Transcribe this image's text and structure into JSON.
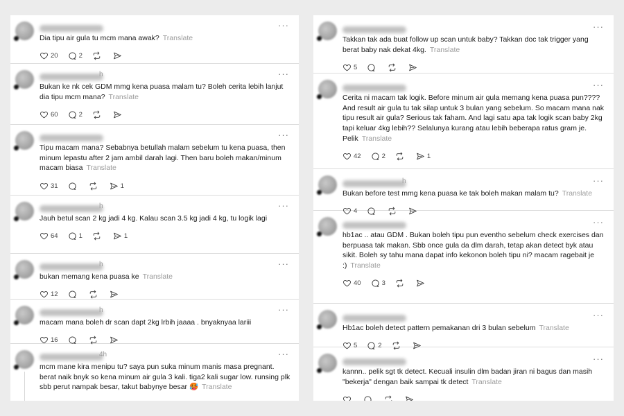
{
  "left": [
    {
      "time": "",
      "text": "Dia tipu air gula tu mcm mana awak?",
      "translate": "Translate",
      "likes": "20",
      "replies": "2",
      "reposts": "",
      "shares": ""
    },
    {
      "time": "h",
      "text": "Bukan ke nk cek GDM mmg kena puasa malam tu? Boleh cerita lebih lanjut dia tipu mcm mana?",
      "translate": "Translate",
      "likes": "60",
      "replies": "2",
      "reposts": "",
      "shares": ""
    },
    {
      "time": "",
      "text": "Tipu macam mana? Sebabnya betullah malam sebelum tu kena puasa, then minum lepastu after 2 jam ambil darah lagi. Then baru boleh makan/minum macam biasa",
      "translate": "Translate",
      "likes": "31",
      "replies": "",
      "reposts": "",
      "shares": "1"
    },
    {
      "time": "h",
      "text": "Jauh betul scan 2 kg jadi 4 kg. Kalau scan 3.5 kg jadi 4 kg, tu logik lagi",
      "translate": "",
      "likes": "64",
      "replies": "1",
      "reposts": "",
      "shares": "1"
    },
    {
      "time": "h",
      "text": "bukan memang kena puasa ke",
      "translate": "Translate",
      "likes": "12",
      "replies": "",
      "reposts": "",
      "shares": ""
    },
    {
      "time": "h",
      "text": "macam mana boleh dr scan dapt 2kg lrbih jaaaa . bnyaknyaa lariii",
      "translate": "",
      "likes": "16",
      "replies": "",
      "reposts": "",
      "shares": ""
    },
    {
      "time": "4h",
      "text": "mcm mane kira menipu tu? saya pun suka minum manis masa pregnant. berat naik bnyk so kena minum air gula 3 kali. tiga2 kali sugar low. runsing plk sbb perut nampak besar, takut babynye besar 🥵",
      "translate": "Translate",
      "likes": "",
      "replies": "",
      "reposts": "",
      "shares": ""
    }
  ],
  "right": [
    {
      "time": "",
      "text": "Takkan tak ada buat follow up scan untuk baby? Takkan doc tak trigger yang berat baby nak dekat 4kg.",
      "translate": "Translate",
      "likes": "5",
      "replies": "",
      "reposts": "",
      "shares": ""
    },
    {
      "time": "",
      "text": "Cerita ni macam tak logik. Before minum air gula memang kena puasa pun???? And result air gula tu tak silap untuk 3 bulan yang sebelum. So macam mana nak tipu result air gula? Serious tak faham. And lagi satu apa tak logik scan baby 2kg tapi keluar 4kg lebih?? Selalunya kurang atau lebih beberapa ratus gram je. Pelik",
      "translate": "Translate",
      "likes": "42",
      "replies": "2",
      "reposts": "",
      "shares": "1"
    },
    {
      "time": "h",
      "text": "Bukan before test mmg kena puasa ke tak boleh makan malam tu?",
      "translate": "Translate",
      "likes": "4",
      "replies": "",
      "reposts": "",
      "shares": ""
    },
    {
      "time": "",
      "text": "hb1ac .. atau GDM . Bukan boleh tipu pun eventho sebelum check exercises dan berpuasa tak makan. Sbb once gula da dlm darah, tetap akan detect byk atau sikit. Boleh sy tahu mana dapat info kekonon boleh tipu ni? macam ragebait je :)",
      "translate": "Translate",
      "likes": "40",
      "replies": "3",
      "reposts": "",
      "shares": ""
    },
    {
      "time": "",
      "text": "Hb1ac boleh detect pattern pemakanan dri 3 bulan sebelum",
      "translate": "Translate",
      "likes": "5",
      "replies": "2",
      "reposts": "",
      "shares": ""
    },
    {
      "time": "",
      "text": "kannn.. pelik sgt tk detect. Kecuali insulin dlm badan jiran ni bagus dan masih \"bekerja\" dengan baik sampai tk detect",
      "translate": "Translate",
      "likes": "",
      "replies": "",
      "reposts": "",
      "shares": ""
    }
  ],
  "icons": {
    "more": "more-dots-icon",
    "like": "heart-icon",
    "reply": "comment-icon",
    "repost": "repost-icon",
    "share": "share-icon"
  }
}
